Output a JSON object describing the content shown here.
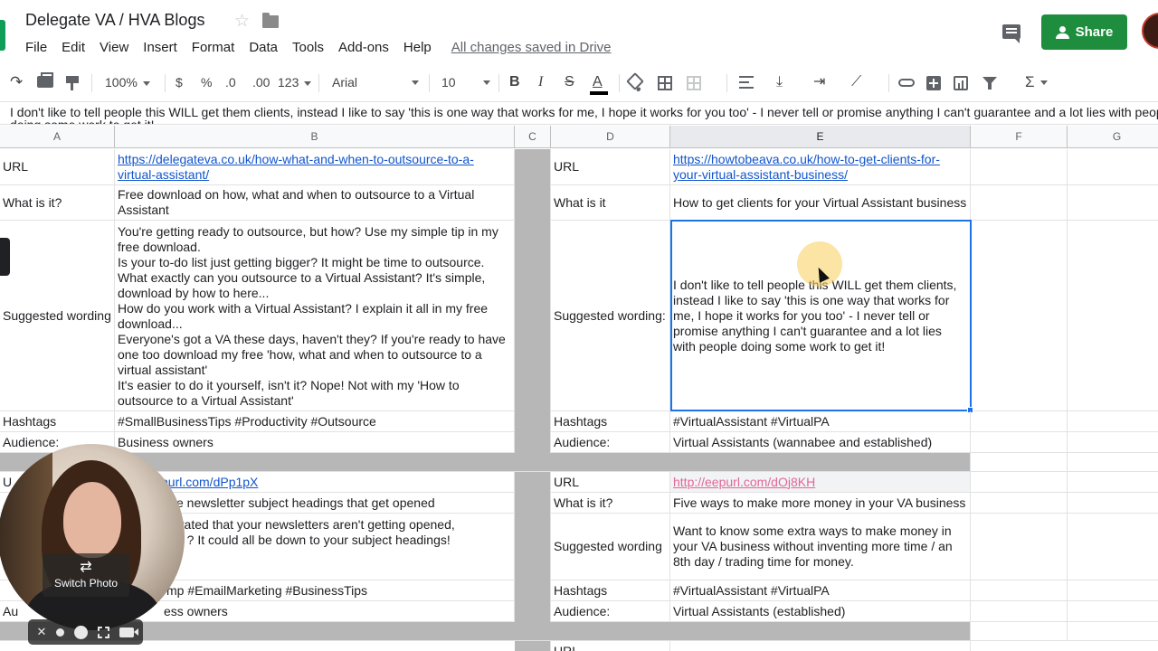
{
  "document": {
    "title": "Delegate VA / HVA Blogs",
    "menu": [
      "File",
      "Edit",
      "View",
      "Insert",
      "Format",
      "Data",
      "Tools",
      "Add-ons",
      "Help"
    ],
    "save_status": "All changes saved in Drive",
    "share_label": "Share"
  },
  "toolbar": {
    "zoom": "100%",
    "currency": "$",
    "percent": "%",
    "decrease_decimal": ".0",
    "increase_decimal": ".00",
    "more_formats": "123",
    "font": "Arial",
    "font_size": "10",
    "bold": "B",
    "italic": "I",
    "strike": "S",
    "text_color": "A",
    "functions": "Σ"
  },
  "formula_bar": {
    "text": "I don't like to tell people this WILL get them clients, instead I like to say 'this is one way that works for me, I hope it works for you too' - I never tell or promise anything I can't guarantee and a lot lies with people doing some work to get it!"
  },
  "columns": [
    "A",
    "B",
    "C",
    "D",
    "E",
    "F",
    "G"
  ],
  "sheet": {
    "block1_left": {
      "url_label": "URL",
      "url": "https://delegateva.co.uk/how-what-and-when-to-outsource-to-a-virtual-assistant/",
      "what_label": "What is it?",
      "what": "Free download on how, what and when to outsource to a Virtual Assistant",
      "wording_label": "Suggested wording",
      "wording_lines": [
        "You're getting ready to outsource, but how? Use my simple tip in my free download.",
        "Is your to-do list just getting bigger? It might be time to outsource.",
        "What exactly can you outsource to a Virtual Assistant? It's simple, download by how to here...",
        "How do you work with a Virtual Assistant? I explain it all in my free download...",
        "Everyone's got a VA these days, haven't they? If you're ready to have one too download my free 'how, what and when to outsource to a virtual assistant'",
        "It's easier to do it yourself, isn't it? Nope! Not with my 'How to outsource to a Virtual Assistant'"
      ],
      "hashtags_label": "Hashtags",
      "hashtags": "#SmallBusinessTips #Productivity #Outsource",
      "audience_label": "Audience:",
      "audience": "Business owners"
    },
    "block1_right": {
      "url_label": "URL",
      "url": "https://howtobeava.co.uk/how-to-get-clients-for-your-virtual-assistant-business/",
      "what_label": "What is it",
      "what": "How to get clients for your Virtual Assistant business",
      "wording_label": "Suggested wording:",
      "wording": "I don't like to tell people this WILL get them clients, instead I like to say 'this is one way that works for me, I hope it works for you too' - I never tell or promise anything I can't guarantee and a lot lies with people doing some work to get it!",
      "hashtags_label": "Hashtags",
      "hashtags": "#VirtualAssistant #VirtualPA",
      "audience_label": "Audience:",
      "audience": "Virtual Assistants (wannabee and established)"
    },
    "block2_left": {
      "url_label": "U",
      "url": "purl.com/dPp1pX",
      "what": "ite newsletter subject headings that get opened",
      "wording": "strated that your newsletters aren't getting opened, let ? It could all be down to your subject headings!",
      "hashtags": "mp #EmailMarketing #BusinessTips",
      "audience_label": "Au",
      "audience": "ess owners"
    },
    "block2_right": {
      "url_label": "URL",
      "url": "http://eepurl.com/dOj8KH",
      "what_label": "What is it?",
      "what": "Five ways to make more money in your VA business",
      "wording_label": "Suggested wording",
      "wording": "Want to know some extra ways to make money in your VA business without inventing more time / an 8th day / trading time for money.",
      "hashtags_label": "Hashtags",
      "hashtags": "#VirtualAssistant #VirtualPA",
      "audience_label": "Audience:",
      "audience": "Virtual Assistants (established)"
    },
    "block3_right": {
      "url_label": "URL"
    }
  },
  "webcam": {
    "switch_label": "Switch Photo",
    "close": "✕"
  },
  "colors": {
    "share_green": "#1e8e3e",
    "selection_blue": "#1a73e8",
    "link_blue": "#1155cc",
    "separator_grey": "#b7b7b7",
    "visited_link_pink": "#e2679a"
  }
}
